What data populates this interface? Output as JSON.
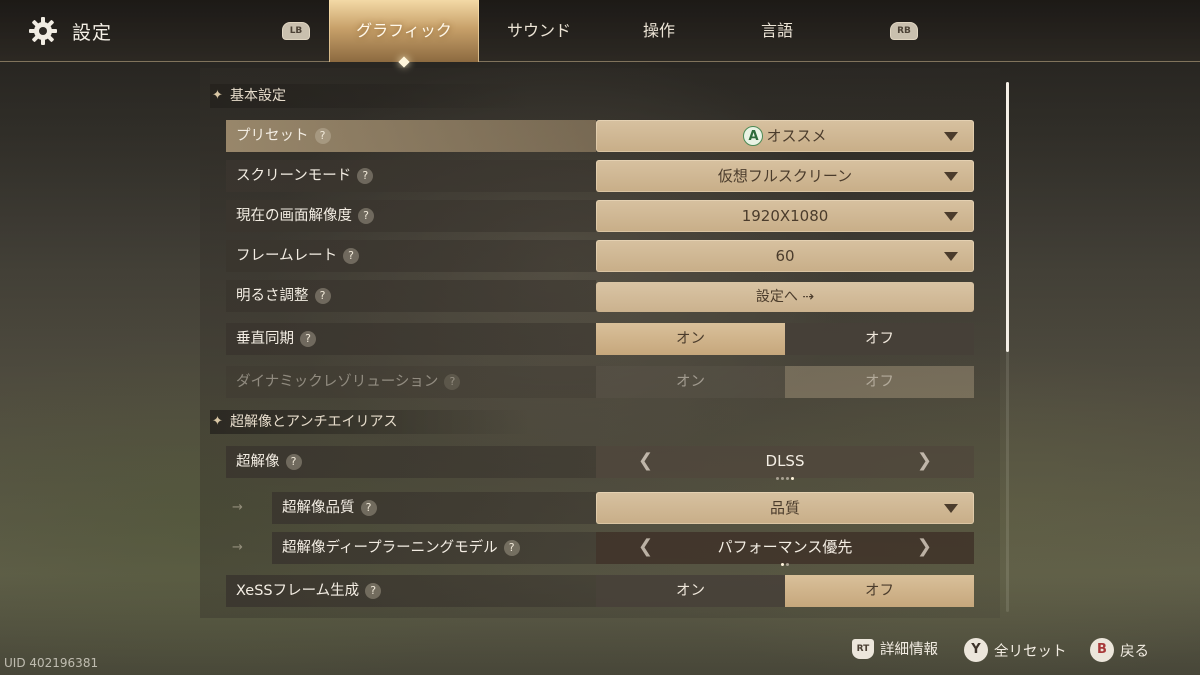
{
  "header": {
    "title": "設定",
    "left_bumper": "LB",
    "right_bumper": "RB",
    "tabs": [
      {
        "label": "グラフィック",
        "active": true
      },
      {
        "label": "サウンド",
        "active": false
      },
      {
        "label": "操作",
        "active": false
      },
      {
        "label": "言語",
        "active": false
      }
    ]
  },
  "sections": {
    "basic": "基本設定",
    "super_res": "超解像とアンチエイリアス"
  },
  "settings": {
    "preset": {
      "label": "プリセット",
      "button": "A",
      "value": "オススメ"
    },
    "screen_mode": {
      "label": "スクリーンモード",
      "value": "仮想フルスクリーン"
    },
    "resolution": {
      "label": "現在の画面解像度",
      "value": "1920X1080"
    },
    "frame_rate": {
      "label": "フレームレート",
      "value": "60"
    },
    "brightness": {
      "label": "明るさ調整",
      "value": "設定へ ⇢"
    },
    "vsync": {
      "label": "垂直同期",
      "on": "オン",
      "off": "オフ",
      "selected": "オン"
    },
    "dynamic_res": {
      "label": "ダイナミックレゾリューション",
      "on": "オン",
      "off": "オフ",
      "selected": "オフ",
      "disabled": true
    },
    "super_resolution": {
      "label": "超解像",
      "value": "DLSS",
      "options_count": 4,
      "current_index": 3
    },
    "sr_quality": {
      "label": "超解像品質",
      "value": "品質"
    },
    "sr_model": {
      "label": "超解像ディープラーニングモデル",
      "value": "パフォーマンス優先",
      "options_count": 2,
      "current_index": 0
    },
    "xess_frame": {
      "label": "XeSSフレーム生成",
      "on": "オン",
      "off": "オフ",
      "selected": "オフ"
    }
  },
  "help_glyph": "?",
  "footer": {
    "uid": "UID 402196381",
    "hints": [
      {
        "button": "RT",
        "label": "詳細情報"
      },
      {
        "button": "Y",
        "label": "全リセット"
      },
      {
        "button": "B",
        "label": "戻る"
      }
    ]
  },
  "colors": {
    "accent": "#c8a16a",
    "panel_light": "#d7c1a0",
    "text_dark": "#4b3c2c"
  }
}
